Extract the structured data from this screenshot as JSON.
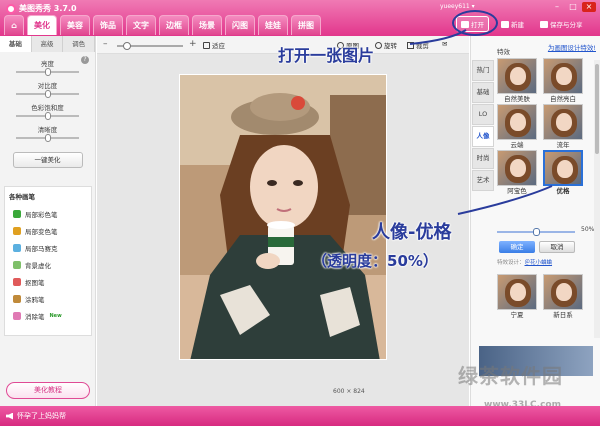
{
  "app": {
    "title": "美图秀秀 3.7.0",
    "user": "yueey611 ▾"
  },
  "window_controls": [
    "–",
    "□",
    "×"
  ],
  "main_tabs": [
    {
      "label": "⌂",
      "active": false,
      "home": true
    },
    {
      "label": "美化",
      "active": true
    },
    {
      "label": "美容",
      "active": false
    },
    {
      "label": "饰品",
      "active": false
    },
    {
      "label": "文字",
      "active": false
    },
    {
      "label": "边框",
      "active": false
    },
    {
      "label": "场景",
      "active": false
    },
    {
      "label": "闪图",
      "active": false
    },
    {
      "label": "娃娃",
      "active": false
    },
    {
      "label": "拼图",
      "active": false
    }
  ],
  "toolbar": {
    "open": "打开",
    "new": "新建",
    "save_share": "保存与分享"
  },
  "left_panel": {
    "tabs": [
      "基础",
      "高级",
      "调色"
    ],
    "help": "?",
    "sliders": [
      {
        "label": "亮度",
        "value": 0.5
      },
      {
        "label": "对比度",
        "value": 0.5
      },
      {
        "label": "色彩饱和度",
        "value": 0.5
      },
      {
        "label": "清晰度",
        "value": 0.5
      }
    ],
    "one_click": "一键美化",
    "brushes_title": "各种画笔",
    "brushes": [
      {
        "label": "局部彩色笔",
        "new": false,
        "color": "#3aa83a"
      },
      {
        "label": "局部变色笔",
        "new": false,
        "color": "#e0a020"
      },
      {
        "label": "局部马赛克",
        "new": false,
        "color": "#5bb0e0"
      },
      {
        "label": "背景虚化",
        "new": false,
        "color": "#7fc06a"
      },
      {
        "label": "抠图笔",
        "new": false,
        "color": "#e05a5a"
      },
      {
        "label": "涂鸦笔",
        "new": false,
        "color": "#c08a3a"
      },
      {
        "label": "消除笔",
        "new": true,
        "color": "#e07ab4"
      }
    ],
    "new_badge": "New",
    "tutorial": "美化教程"
  },
  "canvas": {
    "zoom_minus": "–",
    "zoom_plus": "+",
    "zoom_level": 0.1,
    "fit": "适应",
    "tools": [
      "原图",
      "旋转",
      "裁剪",
      "✉"
    ],
    "dimensions": "600 × 824"
  },
  "right_panel": {
    "link": "为画图设计特效!",
    "special": "特效",
    "tabs": [
      {
        "label": "热门",
        "active": false
      },
      {
        "label": "基础",
        "active": false
      },
      {
        "label": "LO",
        "active": false
      },
      {
        "label": "人像",
        "active": true
      },
      {
        "label": "时尚",
        "active": false
      },
      {
        "label": "艺术",
        "active": false
      }
    ],
    "effects": [
      {
        "label": "自然美肤",
        "selected": false
      },
      {
        "label": "自然亮白",
        "selected": false
      },
      {
        "label": "云端",
        "selected": false
      },
      {
        "label": "流年",
        "selected": false
      },
      {
        "label": "阿宝色",
        "selected": false
      },
      {
        "label": "优格",
        "selected": true
      },
      {
        "label": "宁夏",
        "selected": false
      },
      {
        "label": "新日系",
        "selected": false
      }
    ],
    "opacity": 0.5,
    "opacity_text": "50%",
    "ok": "确定",
    "cancel": "取消",
    "designer_label": "特效设计：",
    "designer": "＠花小蛐蛐"
  },
  "annotations": {
    "open_pic": "打开一张图片",
    "portrait": "人像-优格",
    "opacity_note": "（透明度：50%）"
  },
  "status": {
    "message": "怀孕了上妈妈帮"
  },
  "watermark": {
    "text": "绿茶软件园",
    "url": "www.33LC.com"
  },
  "colors": {
    "brand_pink": "#e2368c",
    "annotation_blue": "#2a3c9c",
    "accent_blue": "#2a70d8"
  }
}
